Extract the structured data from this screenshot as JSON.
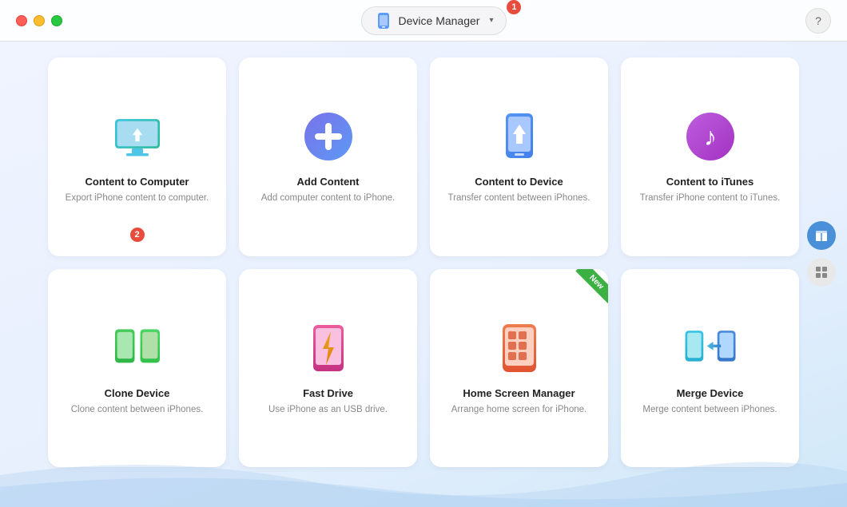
{
  "titlebar": {
    "app_title": "Device Manager",
    "help_label": "?",
    "badge1": "1"
  },
  "cards": [
    {
      "id": "content-to-computer",
      "title": "Content to Computer",
      "desc": "Export iPhone content to computer.",
      "badge2": "2",
      "icon": "computer-download"
    },
    {
      "id": "add-content",
      "title": "Add Content",
      "desc": "Add computer content to iPhone.",
      "icon": "plus-circle"
    },
    {
      "id": "content-to-device",
      "title": "Content to Device",
      "desc": "Transfer content between iPhones.",
      "icon": "iphone-down"
    },
    {
      "id": "content-to-itunes",
      "title": "Content to iTunes",
      "desc": "Transfer iPhone content to iTunes.",
      "icon": "music-note"
    },
    {
      "id": "clone-device",
      "title": "Clone Device",
      "desc": "Clone content between iPhones.",
      "icon": "clone-phones"
    },
    {
      "id": "fast-drive",
      "title": "Fast Drive",
      "desc": "Use iPhone as an USB drive.",
      "icon": "lightning-phone"
    },
    {
      "id": "home-screen-manager",
      "title": "Home Screen Manager",
      "desc": "Arrange home screen for iPhone.",
      "icon": "home-grid",
      "new": true
    },
    {
      "id": "merge-device",
      "title": "Merge Device",
      "desc": "Merge content between iPhones.",
      "icon": "merge-arrow"
    }
  ],
  "side_buttons": [
    {
      "id": "blue-btn",
      "icon": "box-icon"
    },
    {
      "id": "grid-btn",
      "icon": "grid-icon"
    }
  ]
}
